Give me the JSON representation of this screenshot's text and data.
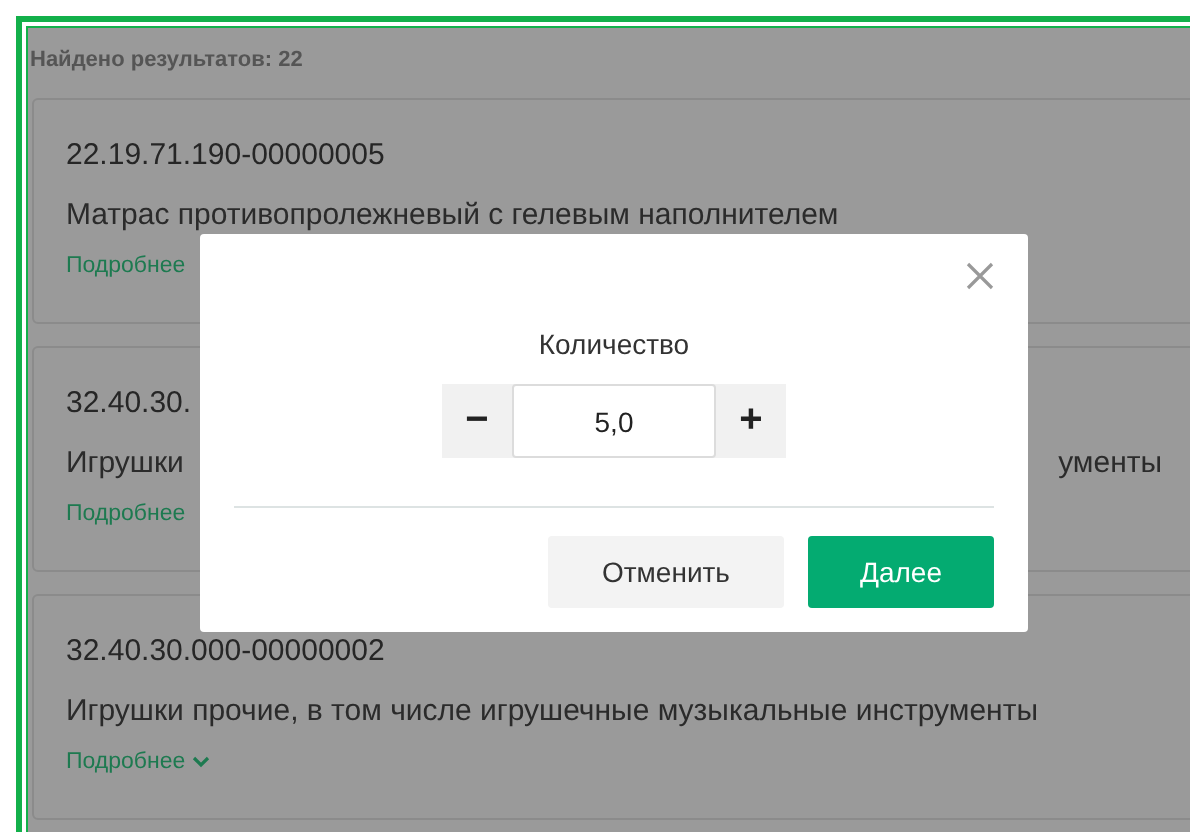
{
  "results_count": "Найдено результатов: 22",
  "results": [
    {
      "code": "22.19.71.190-00000005",
      "description_parts": [
        "Матрас противопролежневый с гелевым наполнителем"
      ],
      "more": "Подробнее",
      "chevron": false
    },
    {
      "code": "32.40.30.",
      "description_parts": [
        "Игрушки",
        "ументы"
      ],
      "more": "Подробнее",
      "chevron": false
    },
    {
      "code": "32.40.30.000-00000002",
      "description_parts": [
        "Игрушки прочие, в том числе игрушечные музыкальные инструменты"
      ],
      "more": "Подробнее",
      "chevron": true
    }
  ],
  "dialog": {
    "label": "Количество",
    "minus": "−",
    "value": "5,0",
    "plus": "+",
    "buttons": [
      {
        "label": "Отменить",
        "kind": "secondary"
      },
      {
        "label": "Далее",
        "kind": "primary"
      }
    ]
  }
}
